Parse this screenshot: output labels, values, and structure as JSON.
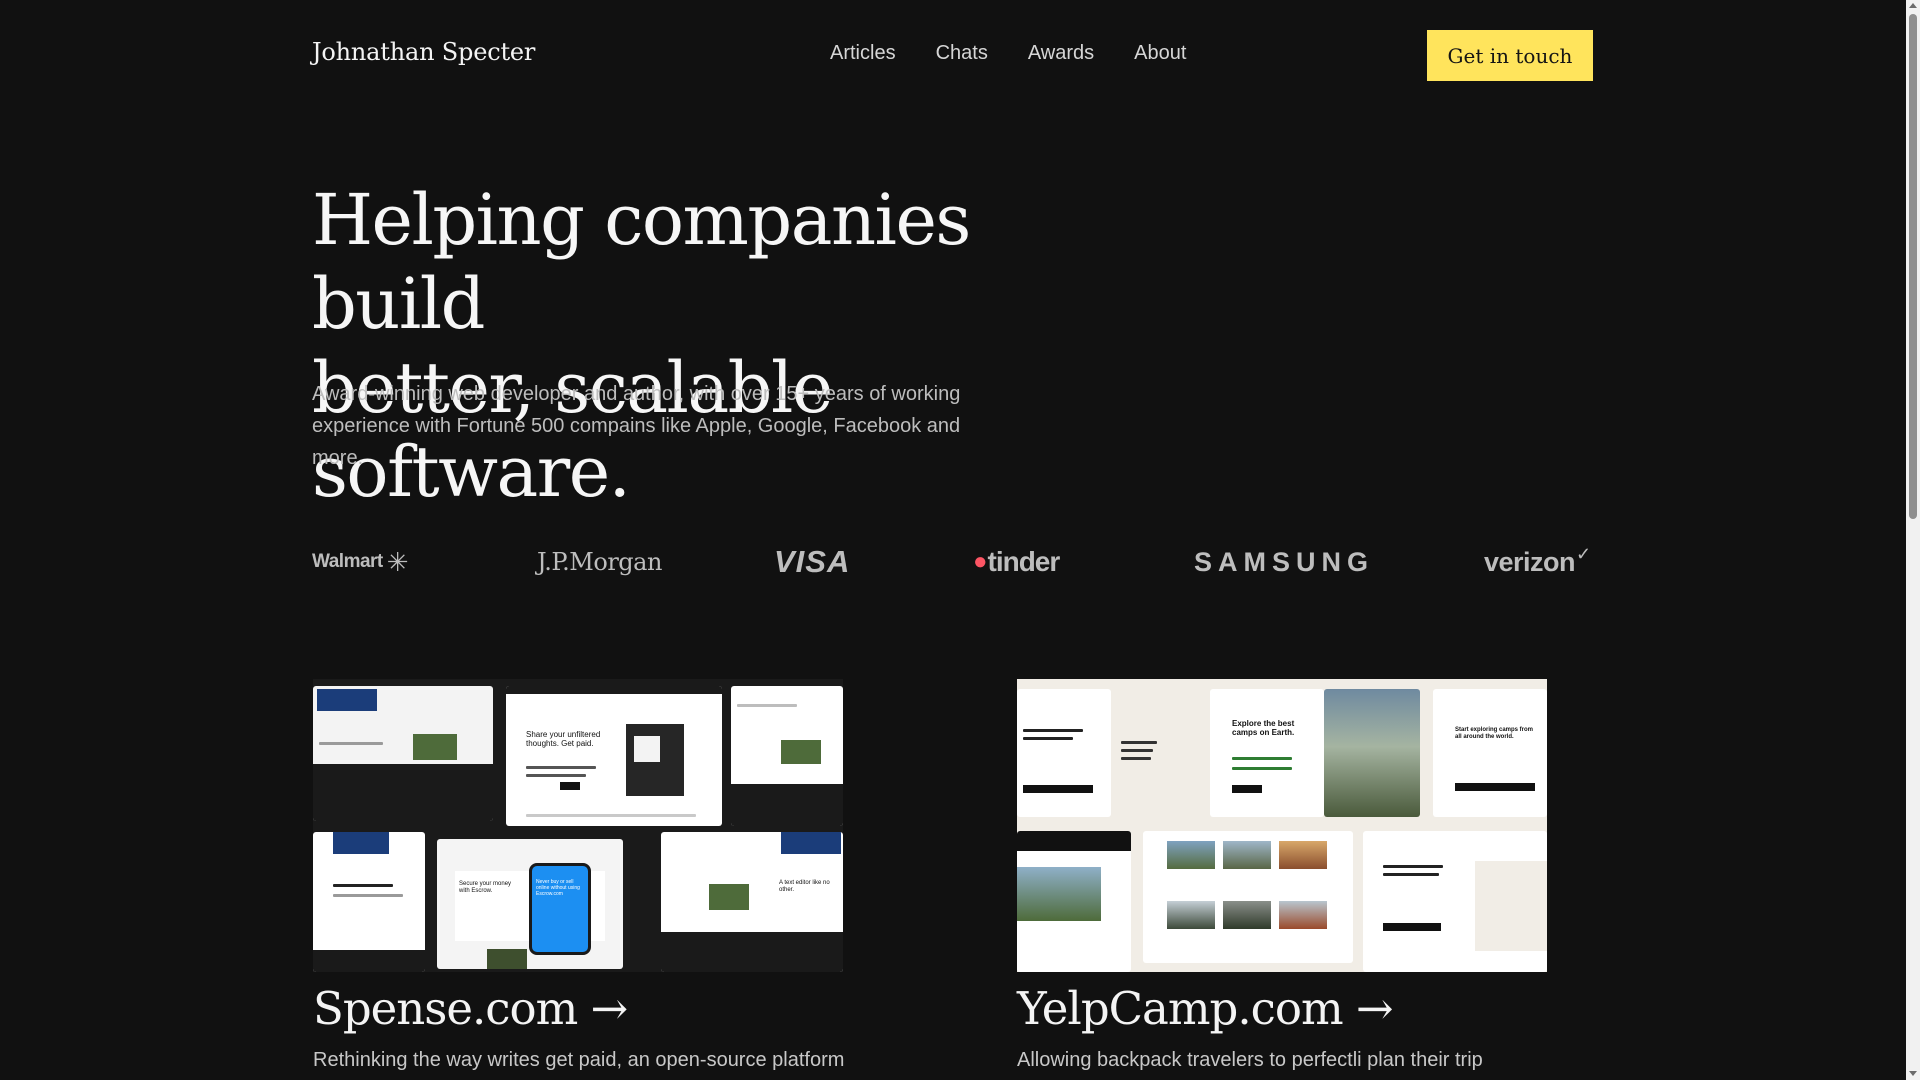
{
  "header": {
    "brand": "Johnathan Specter",
    "nav": [
      "Articles",
      "Chats",
      "Awards",
      "About"
    ],
    "cta": "Get in touch"
  },
  "hero": {
    "title_line1": "Helping companies build",
    "title_line2": "better, scalable software.",
    "subtitle": "Award-winning web developer and author, with over 15+ years of working experience with Fortune 500 compains like Apple, Google, Facebook and more."
  },
  "logos": {
    "walmart": "Walmart",
    "jpmorgan": "J.P.Morgan",
    "visa": "VISA",
    "tinder": "tinder",
    "samsung": "SAMSUNG",
    "verizon": "verizon"
  },
  "projects": [
    {
      "title": "Spense.com →",
      "description": "Rethinking the way writes get paid, an open-source platform",
      "thumb_texts": [
        "Share your unfiltered thoughts. Get paid.",
        "Secure your money with Escrow.",
        "Never buy or sell online without using Escrow.com",
        "A text editor like no other."
      ]
    },
    {
      "title": "YelpCamp.com →",
      "description": "Allowing backpack travelers to perfectli plan their trip",
      "thumb_texts": [
        "Explore the best camps on Earth.",
        "Start exploring camps from all around the world."
      ]
    }
  ],
  "colors": {
    "background": "#111111",
    "accent": "#ffe45c",
    "tinder": "#fd5564"
  }
}
